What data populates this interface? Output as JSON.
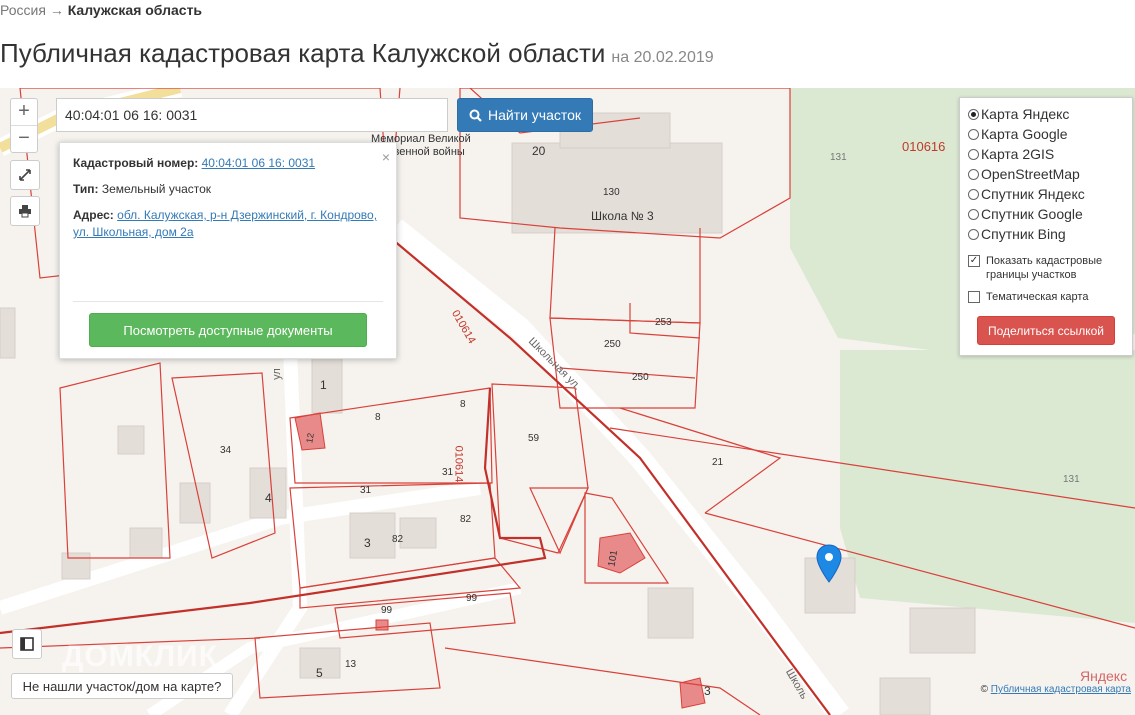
{
  "breadcrumb": {
    "country": "Россия",
    "separator": "→",
    "region": "Калужская область"
  },
  "title": {
    "text": "Публичная кадастровая карта Калужской области",
    "date": "на 20.02.2019"
  },
  "search": {
    "value": "40:04:01 06 16: 0031",
    "button_label": "Найти участок",
    "button_icon": "search-icon"
  },
  "zoom": {
    "in_label": "+",
    "out_label": "−"
  },
  "popup": {
    "close_label": "×",
    "cadastral_label": "Кадастровый номер:",
    "cadastral_value": "40:04:01 06 16: 0031",
    "type_label": "Тип:",
    "type_value": "Земельный участок",
    "address_label": "Адрес:",
    "address_line1": "обл. Калужская, р-н Дзержинский, г. Кондрово,",
    "address_line2": "ул. Школьная, дом 2а",
    "docs_button": "Посмотреть доступные документы"
  },
  "layers": {
    "options": [
      {
        "label": "Карта Яндекс",
        "selected": true
      },
      {
        "label": "Карта Google",
        "selected": false
      },
      {
        "label": "Карта 2GIS",
        "selected": false
      },
      {
        "label": "OpenStreetMap",
        "selected": false
      },
      {
        "label": "Спутник Яндекс",
        "selected": false
      },
      {
        "label": "Спутник Google",
        "selected": false
      },
      {
        "label": "Спутник Bing",
        "selected": false
      }
    ],
    "show_borders_line1": "Показать кадастровые",
    "show_borders_line2": "границы участков",
    "show_borders_checked": true,
    "thematic_label": "Тематическая карта",
    "thematic_checked": false,
    "share_button": "Поделиться ссылкой"
  },
  "map_labels": {
    "memorial_1": "Мемориал Великой",
    "memorial_2": "ственной войны",
    "school": "Школа № 3",
    "street_shkolnaya": "Школьная ул.",
    "street_shkolnaya2": "Школь",
    "quarter_010616": "010616",
    "quarter_010614": "010614",
    "quarter_010614b": "010614",
    "n20": "20",
    "n130": "130",
    "n131a": "131",
    "n131b": "131",
    "n253": "253",
    "n250a": "250",
    "n250b": "250",
    "n21": "21",
    "n59": "59",
    "n34": "34",
    "n8a": "8",
    "n8b": "8",
    "n31a": "31",
    "n31b": "31",
    "n82a": "82",
    "n82b": "82",
    "n3a": "3",
    "n3b": "3",
    "n1": "1",
    "n4": "4",
    "n99a": "99",
    "n99b": "99",
    "n5": "5",
    "n13": "13",
    "n101": "101",
    "n12": "12",
    "ul": "ул",
    "watermark": "ДОМКЛИК",
    "yandex": "Яндекс"
  },
  "footer": {
    "not_found": "Не нашли участок/дом на карте?",
    "copyright_symbol": "©",
    "copyright_link": "Публичная кадастровая карта"
  },
  "colors": {
    "parcel_border": "#d9413a",
    "green_zone": "#dbe9d3",
    "marker": "#1e88e5",
    "search_button": "#337ab7",
    "docs_button": "#5cb85c",
    "share_button": "#d9534f"
  }
}
